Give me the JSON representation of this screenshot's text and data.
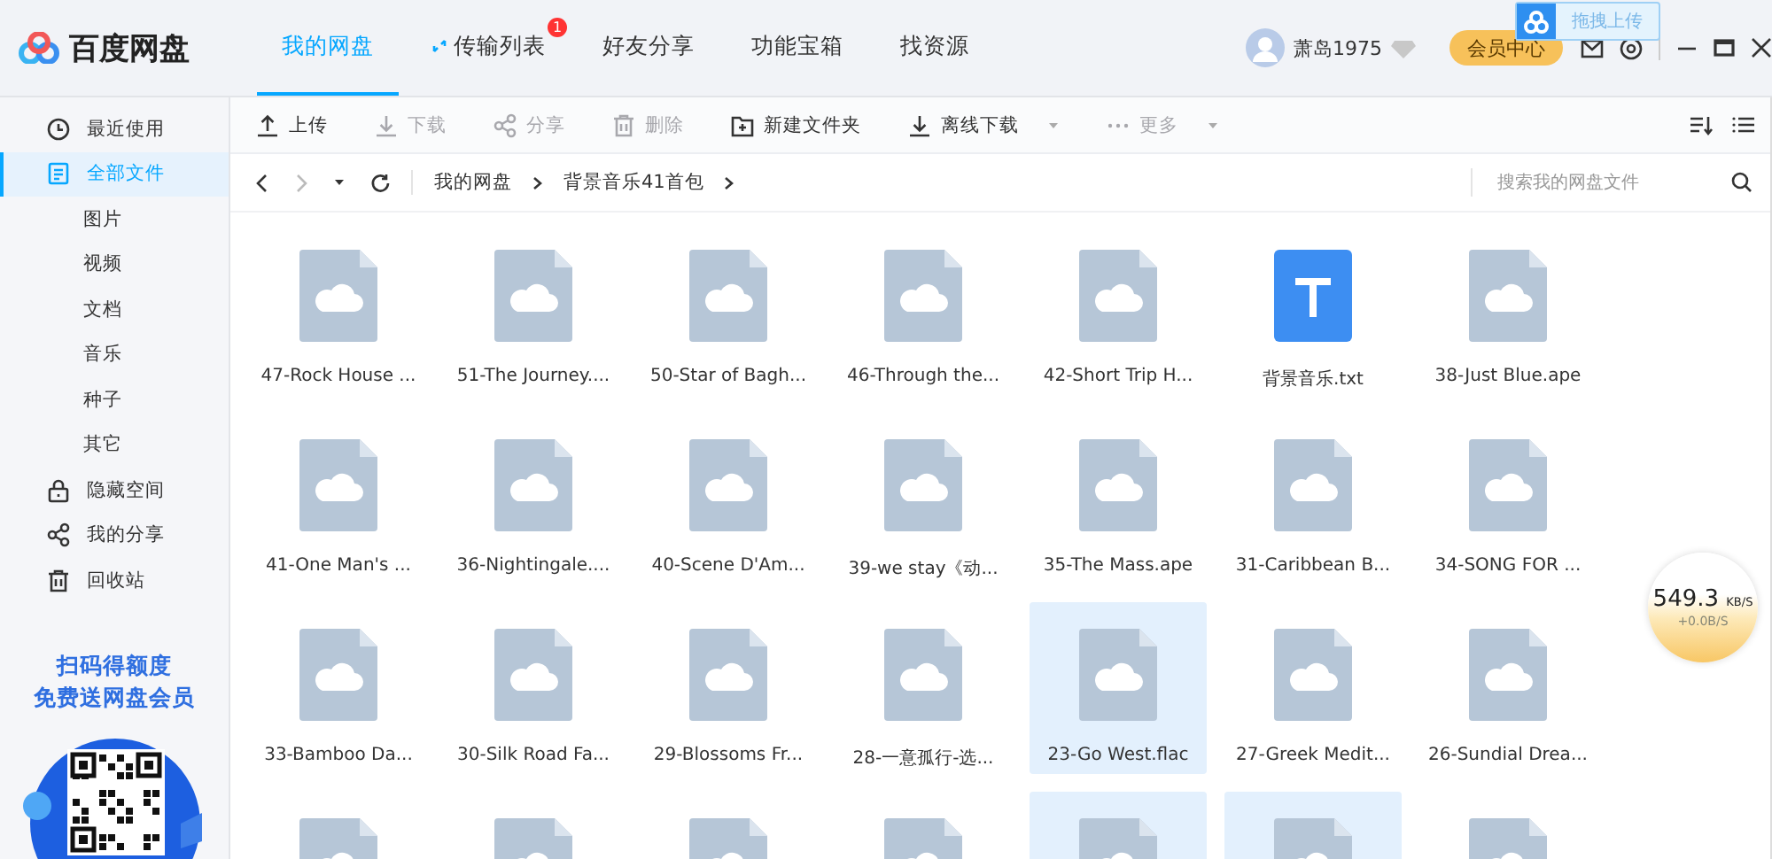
{
  "app": {
    "name": "百度网盘"
  },
  "tabs": [
    {
      "label": "我的网盘",
      "selected": true
    },
    {
      "label": "传输列表",
      "selected": false,
      "badge": "1",
      "kind": "transfer"
    },
    {
      "label": "好友分享",
      "selected": false
    },
    {
      "label": "功能宝箱",
      "selected": false
    },
    {
      "label": "找资源",
      "selected": false
    }
  ],
  "user": {
    "name": "萧岛1975",
    "vip_button": "会员中心"
  },
  "drag_upload": {
    "label": "拖拽上传"
  },
  "sidebar": {
    "items": [
      {
        "label": "最近使用",
        "kind": "clock",
        "selected": false
      },
      {
        "label": "全部文件",
        "kind": "doc",
        "selected": true,
        "children": [
          {
            "label": "图片",
            "selected": false
          },
          {
            "label": "视频",
            "selected": false
          },
          {
            "label": "文档",
            "selected": false
          },
          {
            "label": "音乐",
            "selected": false
          },
          {
            "label": "种子",
            "selected": false
          },
          {
            "label": "其它",
            "selected": false
          }
        ]
      },
      {
        "label": "隐藏空间",
        "kind": "lock",
        "selected": false
      },
      {
        "label": "我的分享",
        "kind": "share",
        "selected": false
      },
      {
        "label": "回收站",
        "kind": "trash",
        "selected": false
      }
    ],
    "promo": [
      "扫码得额度",
      "免费送网盘会员"
    ]
  },
  "toolbar": [
    {
      "label": "上传",
      "kind": "upload",
      "disabled": false
    },
    {
      "label": "下载",
      "kind": "download",
      "disabled": true
    },
    {
      "label": "分享",
      "kind": "share",
      "disabled": true
    },
    {
      "label": "删除",
      "kind": "delete",
      "disabled": true
    },
    {
      "label": "新建文件夹",
      "kind": "folder",
      "disabled": false
    },
    {
      "label": "离线下载",
      "kind": "offline",
      "disabled": false,
      "dropdown": true
    },
    {
      "label": "更多",
      "kind": "more",
      "disabled": true,
      "dropdown": true
    }
  ],
  "breadcrumb": [
    "我的网盘",
    "背景音乐41首包"
  ],
  "search": {
    "placeholder": "搜索我的网盘文件"
  },
  "files": [
    {
      "name": "47-Rock House ...",
      "kind": "audio",
      "selected": false
    },
    {
      "name": "51-The Journey....",
      "kind": "audio",
      "selected": false
    },
    {
      "name": "50-Star of Bagh...",
      "kind": "audio",
      "selected": false
    },
    {
      "name": "46-Through the...",
      "kind": "audio",
      "selected": false
    },
    {
      "name": "42-Short Trip H...",
      "kind": "audio",
      "selected": false
    },
    {
      "name": "背景音乐.txt",
      "kind": "text",
      "selected": false
    },
    {
      "name": "38-Just Blue.ape",
      "kind": "audio",
      "selected": false
    },
    {
      "name": "41-One Man's ...",
      "kind": "audio",
      "selected": false
    },
    {
      "name": "36-Nightingale....",
      "kind": "audio",
      "selected": false
    },
    {
      "name": "40-Scene D'Am...",
      "kind": "audio",
      "selected": false
    },
    {
      "name": "39-we stay《动...",
      "kind": "audio",
      "selected": false
    },
    {
      "name": "35-The Mass.ape",
      "kind": "audio",
      "selected": false
    },
    {
      "name": "31-Caribbean B...",
      "kind": "audio",
      "selected": false
    },
    {
      "name": "34-SONG FOR ...",
      "kind": "audio",
      "selected": false
    },
    {
      "name": "33-Bamboo Da...",
      "kind": "audio",
      "selected": false
    },
    {
      "name": "30-Silk Road Fa...",
      "kind": "audio",
      "selected": false
    },
    {
      "name": "29-Blossoms Fr...",
      "kind": "audio",
      "selected": false
    },
    {
      "name": "28-一意孤行-选...",
      "kind": "audio",
      "selected": false
    },
    {
      "name": "23-Go West.flac",
      "kind": "audio",
      "selected": true
    },
    {
      "name": "27-Greek Medit...",
      "kind": "audio",
      "selected": false
    },
    {
      "name": "26-Sundial Drea...",
      "kind": "audio",
      "selected": false
    },
    {
      "kind": "audio",
      "selected": false
    },
    {
      "kind": "audio",
      "selected": false
    },
    {
      "kind": "audio",
      "selected": false
    },
    {
      "kind": "audio",
      "selected": false
    },
    {
      "kind": "audio",
      "selected": true
    },
    {
      "kind": "audio",
      "selected": true
    },
    {
      "kind": "audio",
      "selected": false
    }
  ],
  "speed": {
    "value": "549.3",
    "unit": "KB/S",
    "upload": "+0.0B/S"
  }
}
